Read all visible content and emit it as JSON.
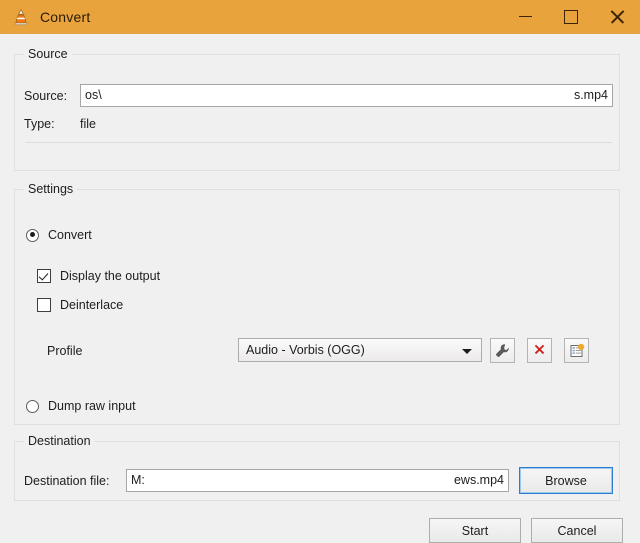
{
  "window": {
    "title": "Convert",
    "app_icon": "vlc-cone-icon",
    "titlebar_color": "#e8a33d",
    "controls": {
      "minimize": "minimize-icon",
      "maximize": "maximize-icon",
      "close": "close-icon"
    }
  },
  "source": {
    "group_title": "Source",
    "source_label": "Source:",
    "source_value_head": "os\\",
    "source_value_tail": "s.mp4",
    "type_label": "Type:",
    "type_value": "file"
  },
  "settings": {
    "group_title": "Settings",
    "convert_label": "Convert",
    "convert_selected": true,
    "display_output_label": "Display the output",
    "display_output_checked": true,
    "deinterlace_label": "Deinterlace",
    "deinterlace_checked": false,
    "profile_label": "Profile",
    "profile_value": "Audio - Vorbis (OGG)",
    "profile_edit_icon": "wrench-icon",
    "profile_delete_icon": "red-x-icon",
    "profile_new_icon": "new-profile-icon",
    "delete_icon_color": "#cc2222",
    "dump_raw_label": "Dump raw input",
    "dump_raw_selected": false
  },
  "destination": {
    "group_title": "Destination",
    "file_label": "Destination file:",
    "file_value_head": "M:",
    "file_value_tail": "ews.mp4",
    "browse_label": "Browse"
  },
  "footer": {
    "start_label": "Start",
    "cancel_label": "Cancel"
  }
}
